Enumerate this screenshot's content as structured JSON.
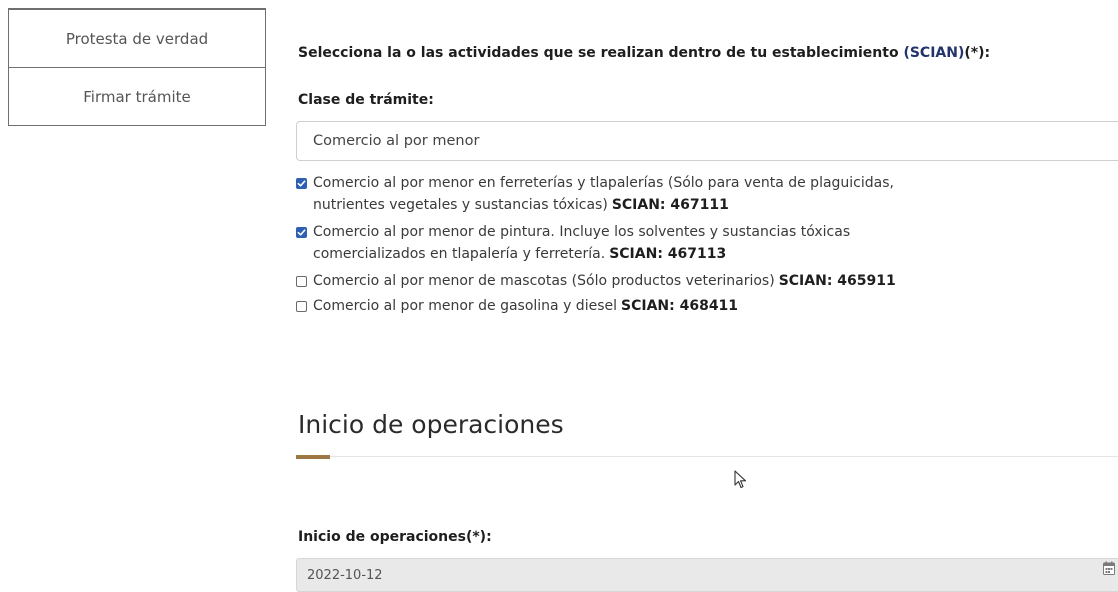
{
  "sidebar": {
    "items": [
      {
        "label": "Protesta de verdad"
      },
      {
        "label": "Firmar trámite"
      }
    ]
  },
  "main": {
    "prompt_text": "Selecciona la o las actividades que se realizan dentro de tu establecimiento ",
    "prompt_link": "(SCIAN)",
    "prompt_suffix": "(*):",
    "clase_label": "Clase de trámite:",
    "clase_value": "Comercio al por menor",
    "activities": [
      {
        "checked": true,
        "line1": "Comercio al por menor en ferreterías y tlapalerías (Sólo para venta de plaguicidas,",
        "line2": "nutrientes vegetales y sustancias tóxicas)",
        "scian": "SCIAN: 467111"
      },
      {
        "checked": true,
        "line1": "Comercio al por menor de pintura. Incluye los solventes y sustancias tóxicas",
        "line2": "comercializados en tlapalería y ferretería.",
        "scian": "SCIAN: 467113"
      },
      {
        "checked": false,
        "line1": "Comercio al por menor de mascotas (Sólo productos veterinarios)",
        "scian": "SCIAN: 465911"
      },
      {
        "checked": false,
        "line1": "Comercio al por menor de gasolina y diesel",
        "scian": "SCIAN: 468411"
      }
    ],
    "section_title": "Inicio de operaciones",
    "date_label": "Inicio de operaciones(*):",
    "date_value": "2022-10-12"
  },
  "colors": {
    "accent": "#9d7845",
    "link": "#23346b",
    "checkbox": "#2f5fb4"
  },
  "icons": {
    "checkbox": "checkbox-icon",
    "calendar": "calendar-icon",
    "cursor": "mouse-pointer-icon"
  }
}
